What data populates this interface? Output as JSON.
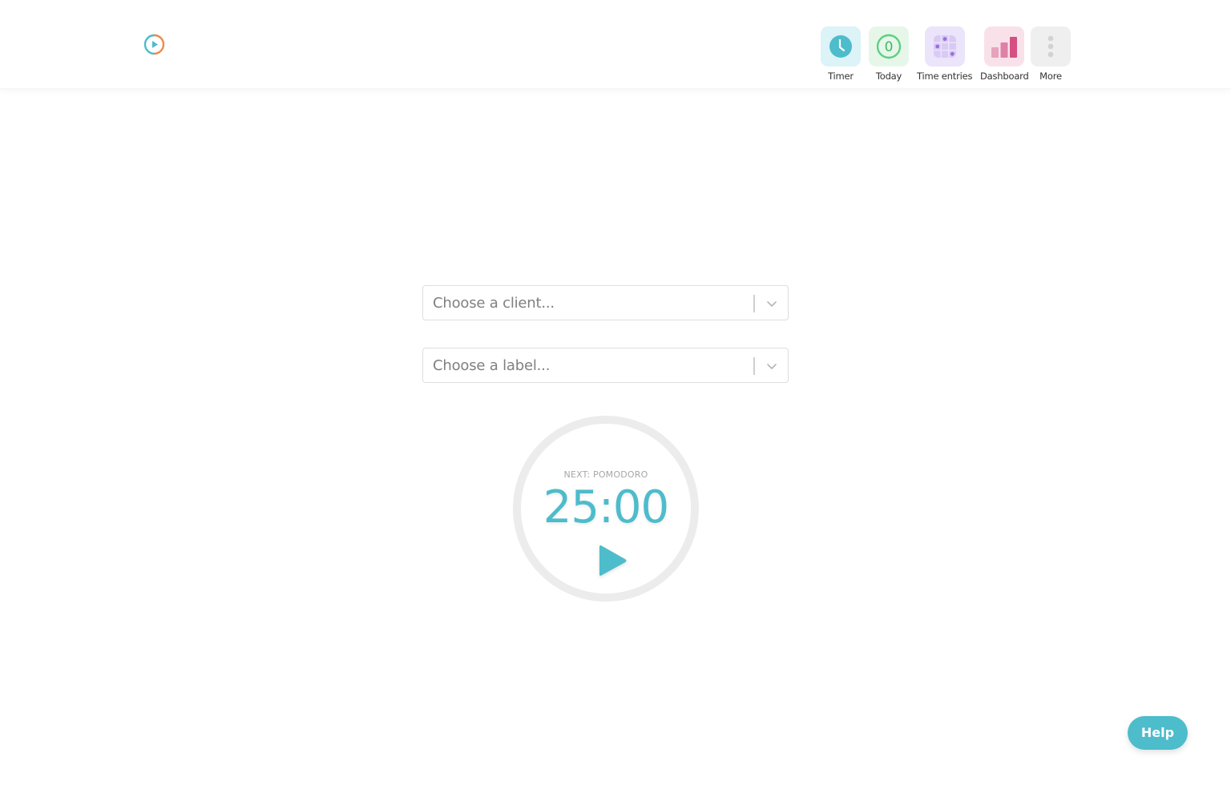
{
  "header": {
    "logo": "pomodoro-logo",
    "nav": [
      {
        "label": "Timer",
        "icon": "clock-icon",
        "tile_color": "#dcf3f7",
        "icon_color": "#4dbccb"
      },
      {
        "label": "Today",
        "icon": "today-count-icon",
        "count": "0",
        "tile_color": "#e6f7ea",
        "icon_color": "#5fcf80"
      },
      {
        "label": "Time entries",
        "icon": "grid-icon",
        "tile_color": "#ece4fa",
        "icon_color": "#9b6ee0"
      },
      {
        "label": "Dashboard",
        "icon": "bar-chart-icon",
        "tile_color": "#f9e1ea",
        "icon_color": "#d54f84"
      },
      {
        "label": "More",
        "icon": "more-vertical-icon",
        "tile_color": "#efefef",
        "icon_color": "#d2d2d2"
      }
    ]
  },
  "form": {
    "client_placeholder": "Choose a client...",
    "label_placeholder": "Choose a label..."
  },
  "timer": {
    "next_label": "NEXT: POMODORO",
    "time": "25:00",
    "accent": "#4dbccb"
  },
  "help": {
    "label": "Help"
  }
}
